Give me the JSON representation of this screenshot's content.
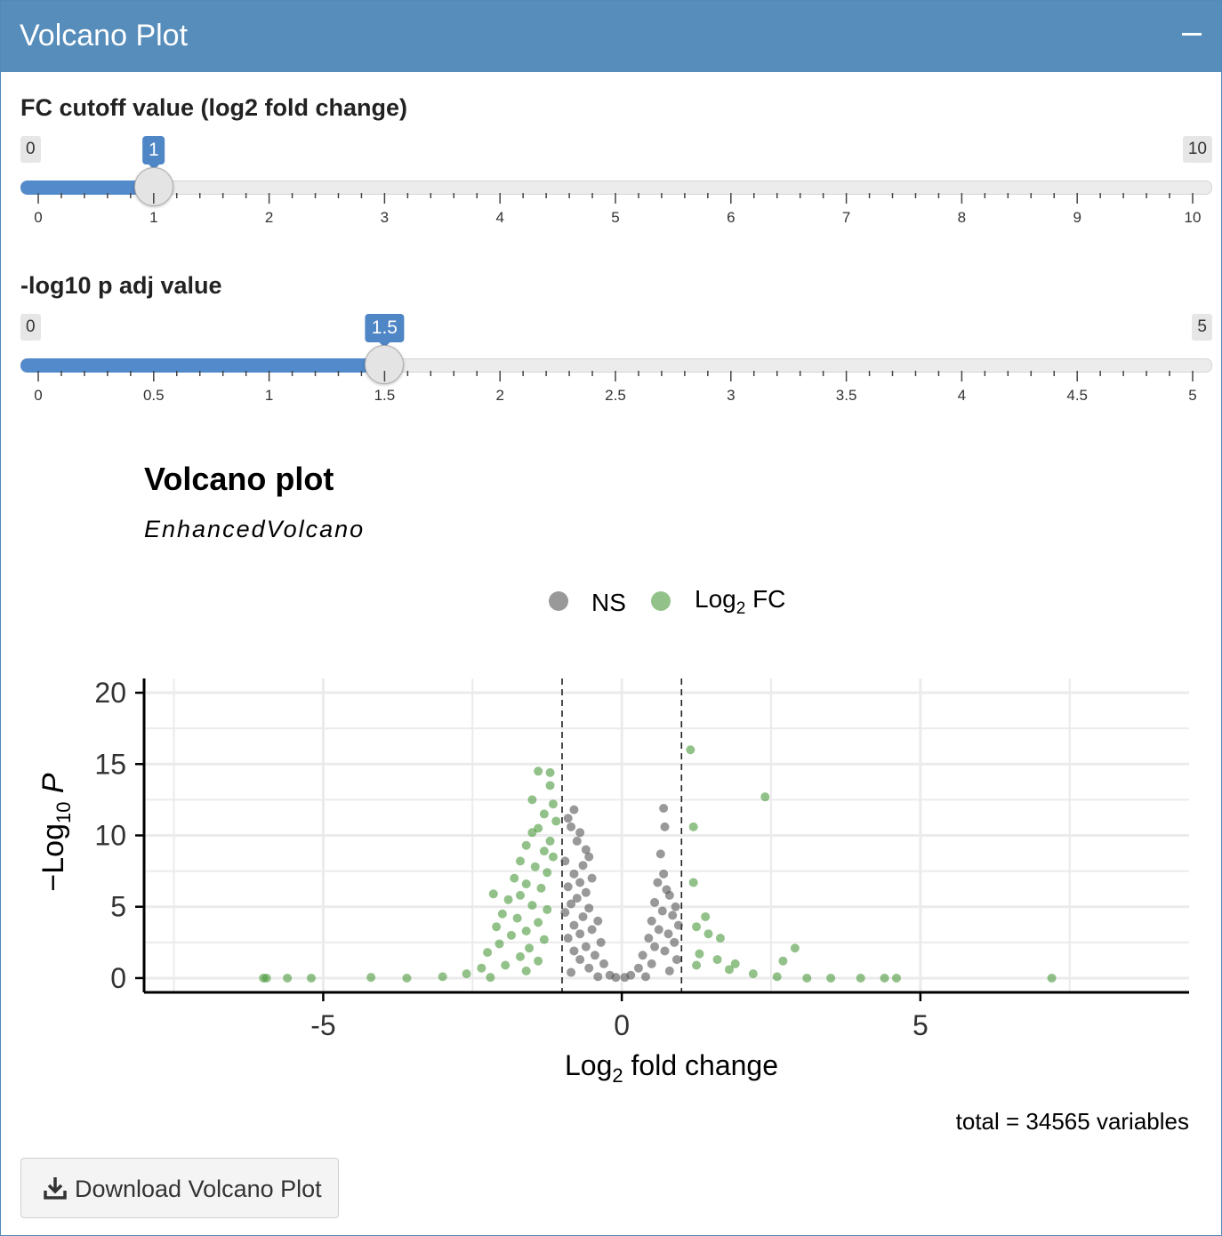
{
  "panel": {
    "title": "Volcano Plot",
    "collapse_label": "−"
  },
  "sliders": [
    {
      "label": "FC cutoff value (log2 fold change)",
      "min": 0,
      "max": 10,
      "value": 1,
      "min_label": "0",
      "max_label": "10",
      "value_label": "1",
      "tick_labels": [
        "0",
        "1",
        "2",
        "3",
        "4",
        "5",
        "6",
        "7",
        "8",
        "9",
        "10"
      ]
    },
    {
      "label": "-log10 p adj value",
      "min": 0,
      "max": 5,
      "value": 1.5,
      "min_label": "0",
      "max_label": "5",
      "value_label": "1.5",
      "tick_labels": [
        "0",
        "0.5",
        "1",
        "1.5",
        "2",
        "2.5",
        "3",
        "3.5",
        "4",
        "4.5",
        "5"
      ]
    }
  ],
  "chart_data": {
    "type": "scatter",
    "title": "Volcano plot",
    "subtitle": "EnhancedVolcano",
    "xlabel": "Log2 fold change",
    "ylabel": "−Log10 P",
    "xlim": [
      -8,
      9.5
    ],
    "ylim": [
      -1,
      21
    ],
    "xticks": [
      -5,
      0,
      5
    ],
    "xtick_labels": [
      "-5",
      "0",
      "5"
    ],
    "yticks": [
      0,
      5,
      10,
      15,
      20
    ],
    "ytick_labels": [
      "0",
      "5",
      "10",
      "15",
      "20"
    ],
    "cutoff_x": [
      -1,
      1
    ],
    "grid": true,
    "legend_position": "top",
    "caption": "total = 34565 variables",
    "series": [
      {
        "name": "NS",
        "color": "#555555",
        "points": [
          [
            -0.8,
            11.8
          ],
          [
            -0.9,
            11.2
          ],
          [
            -0.85,
            10.6
          ],
          [
            -0.7,
            10.2
          ],
          [
            -0.75,
            9.6
          ],
          [
            -0.6,
            9.0
          ],
          [
            -0.55,
            8.5
          ],
          [
            -0.95,
            8.2
          ],
          [
            -0.65,
            7.9
          ],
          [
            -0.8,
            7.3
          ],
          [
            -0.5,
            7.0
          ],
          [
            -0.7,
            6.7
          ],
          [
            -0.9,
            6.4
          ],
          [
            -0.6,
            6.0
          ],
          [
            -0.75,
            5.6
          ],
          [
            -0.85,
            5.2
          ],
          [
            -0.55,
            4.9
          ],
          [
            -0.95,
            4.6
          ],
          [
            -0.65,
            4.3
          ],
          [
            -0.4,
            4.0
          ],
          [
            -0.8,
            3.7
          ],
          [
            -0.5,
            3.4
          ],
          [
            -0.7,
            3.1
          ],
          [
            -0.9,
            2.8
          ],
          [
            -0.35,
            2.5
          ],
          [
            -0.6,
            2.2
          ],
          [
            -0.8,
            1.9
          ],
          [
            -0.45,
            1.6
          ],
          [
            -0.7,
            1.3
          ],
          [
            -0.3,
            1.0
          ],
          [
            -0.55,
            0.7
          ],
          [
            -0.85,
            0.4
          ],
          [
            -0.2,
            0.2
          ],
          [
            -0.4,
            0.1
          ],
          [
            -0.1,
            0.05
          ],
          [
            0.7,
            11.9
          ],
          [
            0.72,
            10.6
          ],
          [
            0.65,
            8.7
          ],
          [
            0.7,
            7.3
          ],
          [
            0.6,
            6.7
          ],
          [
            0.75,
            6.2
          ],
          [
            0.8,
            5.8
          ],
          [
            0.55,
            5.3
          ],
          [
            0.9,
            5.0
          ],
          [
            0.68,
            4.7
          ],
          [
            0.85,
            4.4
          ],
          [
            0.5,
            4.0
          ],
          [
            0.95,
            3.7
          ],
          [
            0.62,
            3.4
          ],
          [
            0.78,
            3.1
          ],
          [
            0.45,
            2.8
          ],
          [
            0.88,
            2.5
          ],
          [
            0.55,
            2.2
          ],
          [
            0.72,
            1.9
          ],
          [
            0.35,
            1.6
          ],
          [
            0.92,
            1.3
          ],
          [
            0.5,
            1.0
          ],
          [
            0.28,
            0.7
          ],
          [
            0.8,
            0.5
          ],
          [
            0.15,
            0.2
          ],
          [
            0.4,
            0.1
          ],
          [
            0.05,
            0.05
          ]
        ]
      },
      {
        "name": "Log2 FC",
        "color": "#4a9a3a",
        "points": [
          [
            -1.4,
            14.5
          ],
          [
            -1.2,
            14.4
          ],
          [
            -1.2,
            13.5
          ],
          [
            -1.5,
            12.5
          ],
          [
            -1.15,
            12.2
          ],
          [
            -1.3,
            11.5
          ],
          [
            -1.1,
            11.0
          ],
          [
            -1.4,
            10.5
          ],
          [
            -1.5,
            10.2
          ],
          [
            -1.2,
            9.6
          ],
          [
            -1.6,
            9.3
          ],
          [
            -1.3,
            8.9
          ],
          [
            -1.15,
            8.5
          ],
          [
            -1.7,
            8.2
          ],
          [
            -1.45,
            7.8
          ],
          [
            -1.25,
            7.4
          ],
          [
            -1.8,
            7.0
          ],
          [
            -1.6,
            6.6
          ],
          [
            -1.35,
            6.3
          ],
          [
            -2.15,
            5.9
          ],
          [
            -1.7,
            5.8
          ],
          [
            -1.9,
            5.5
          ],
          [
            -1.5,
            5.1
          ],
          [
            -1.25,
            4.8
          ],
          [
            -2.0,
            4.5
          ],
          [
            -1.75,
            4.2
          ],
          [
            -1.4,
            3.9
          ],
          [
            -2.1,
            3.6
          ],
          [
            -1.6,
            3.3
          ],
          [
            -1.85,
            3.0
          ],
          [
            -1.3,
            2.7
          ],
          [
            -2.05,
            2.4
          ],
          [
            -1.55,
            2.1
          ],
          [
            -2.25,
            1.8
          ],
          [
            -1.7,
            1.5
          ],
          [
            -1.4,
            1.2
          ],
          [
            -1.95,
            0.9
          ],
          [
            -2.35,
            0.7
          ],
          [
            -1.6,
            0.5
          ],
          [
            -2.6,
            0.3
          ],
          [
            -3.0,
            0.1
          ],
          [
            -4.2,
            0.05
          ],
          [
            -5.2,
            0.0
          ],
          [
            -5.6,
            0.0
          ],
          [
            -5.95,
            0.0
          ],
          [
            -6.0,
            0.0
          ],
          [
            -3.6,
            0.0
          ],
          [
            -2.2,
            0.05
          ],
          [
            1.15,
            16.0
          ],
          [
            2.4,
            12.7
          ],
          [
            1.2,
            10.6
          ],
          [
            1.2,
            6.7
          ],
          [
            1.4,
            4.3
          ],
          [
            1.25,
            3.6
          ],
          [
            1.45,
            3.1
          ],
          [
            1.65,
            2.8
          ],
          [
            2.9,
            2.1
          ],
          [
            1.3,
            1.7
          ],
          [
            1.6,
            1.3
          ],
          [
            2.7,
            1.2
          ],
          [
            1.9,
            1.0
          ],
          [
            1.25,
            0.9
          ],
          [
            1.8,
            0.6
          ],
          [
            2.2,
            0.3
          ],
          [
            2.6,
            0.1
          ],
          [
            3.1,
            0.0
          ],
          [
            3.5,
            0.0
          ],
          [
            4.0,
            0.0
          ],
          [
            4.4,
            0.0
          ],
          [
            4.6,
            0.0
          ],
          [
            7.2,
            0.0
          ]
        ]
      }
    ]
  },
  "download_button": {
    "label": "Download Volcano Plot",
    "icon": "download-icon"
  }
}
